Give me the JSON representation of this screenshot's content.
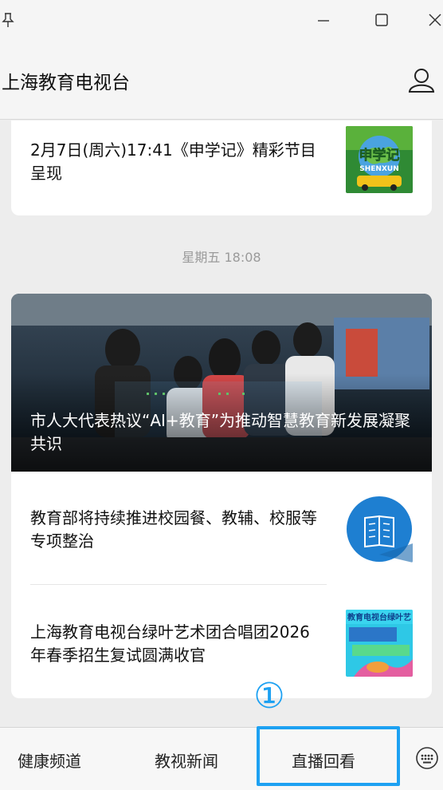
{
  "window": {
    "pin_icon": "pin-icon",
    "minimize_icon": "minimize-icon",
    "maximize_icon": "maximize-icon",
    "close_icon": "close-icon"
  },
  "header": {
    "title": "上海教育电视台",
    "user_icon": "user-icon"
  },
  "feed": {
    "item1": {
      "title": "2月7日(周六)17:41《申学记》精彩节目呈现",
      "thumb_text": "申学记",
      "thumb_subtext": "SHENXUN"
    },
    "timestamp": "星期五 18:08",
    "banner": {
      "title": "市人大代表热议“AI+教育”为推动智慧教育新发展凝聚共识"
    },
    "item2": {
      "title": "教育部将持续推进校园餐、教辅、校服等专项整治"
    },
    "item3": {
      "title": "上海教育电视台绿叶艺术团合唱团2026年春季招生复试圆满收官",
      "thumb_text": "教育电视台绿叶艺"
    }
  },
  "bottom_tabs": [
    {
      "label": "健康频道"
    },
    {
      "label": "教视新闻"
    },
    {
      "label": "直播回看"
    }
  ],
  "keyboard_icon": "keyboard-icon",
  "highlight": {
    "number": "①",
    "color": "#1da1f2"
  }
}
